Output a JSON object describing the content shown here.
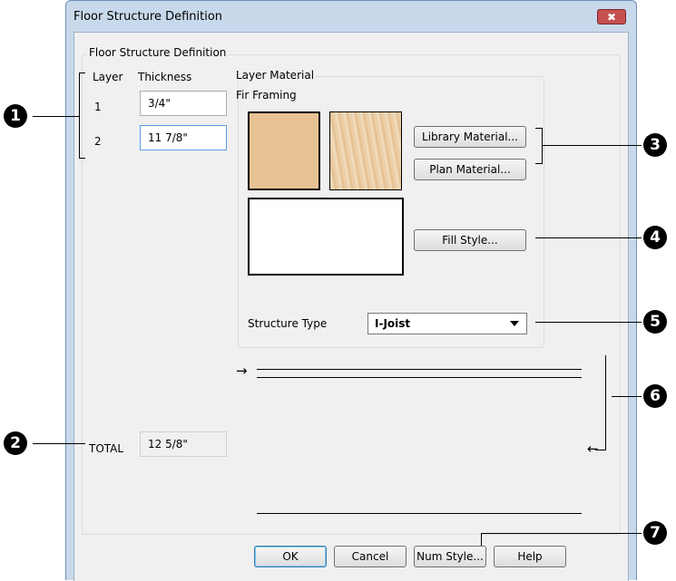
{
  "window": {
    "title": "Floor Structure Definition",
    "close_glyph": "✖"
  },
  "group_main": {
    "label": "Floor Structure Definition"
  },
  "layers": {
    "col_layer": "Layer",
    "col_thickness": "Thickness",
    "rows": [
      {
        "layer": "1",
        "thickness": "3/4\""
      },
      {
        "layer": "2",
        "thickness": "11 7/8\""
      }
    ]
  },
  "total": {
    "label": "TOTAL",
    "value": "12 5/8\""
  },
  "material": {
    "group_label": "Layer Material",
    "name": "Fir Framing",
    "color": "#e8c295",
    "library_button": "Library Material...",
    "plan_button": "Plan Material...",
    "fill_button": "Fill Style..."
  },
  "structure": {
    "label": "Structure Type",
    "value": "I-Joist"
  },
  "buttons": {
    "ok": "OK",
    "cancel": "Cancel",
    "num_style": "Num Style...",
    "help": "Help"
  },
  "callouts": [
    "1",
    "2",
    "3",
    "4",
    "5",
    "6",
    "7"
  ]
}
